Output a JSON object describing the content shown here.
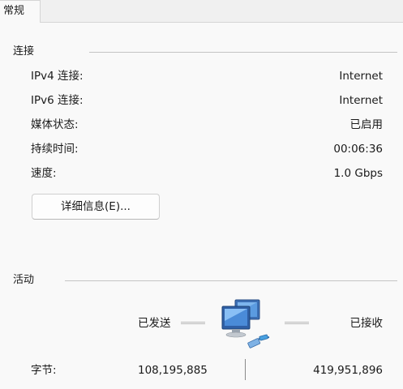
{
  "tabs": [
    {
      "label": "常规"
    }
  ],
  "connection": {
    "title": "连接",
    "rows": [
      {
        "label": "IPv4 连接:",
        "value": "Internet"
      },
      {
        "label": "IPv6 连接:",
        "value": "Internet"
      },
      {
        "label": "媒体状态:",
        "value": "已启用"
      },
      {
        "label": "持续时间:",
        "value": "00:06:36"
      },
      {
        "label": "速度:",
        "value": "1.0 Gbps"
      }
    ],
    "details_button": "详细信息(E)..."
  },
  "activity": {
    "title": "活动",
    "sent_label": "已发送",
    "received_label": "已接收",
    "bytes_label": "字节:",
    "bytes_sent": "108,195,885",
    "bytes_received": "419,951,896",
    "icon": "network-computers-icon"
  }
}
